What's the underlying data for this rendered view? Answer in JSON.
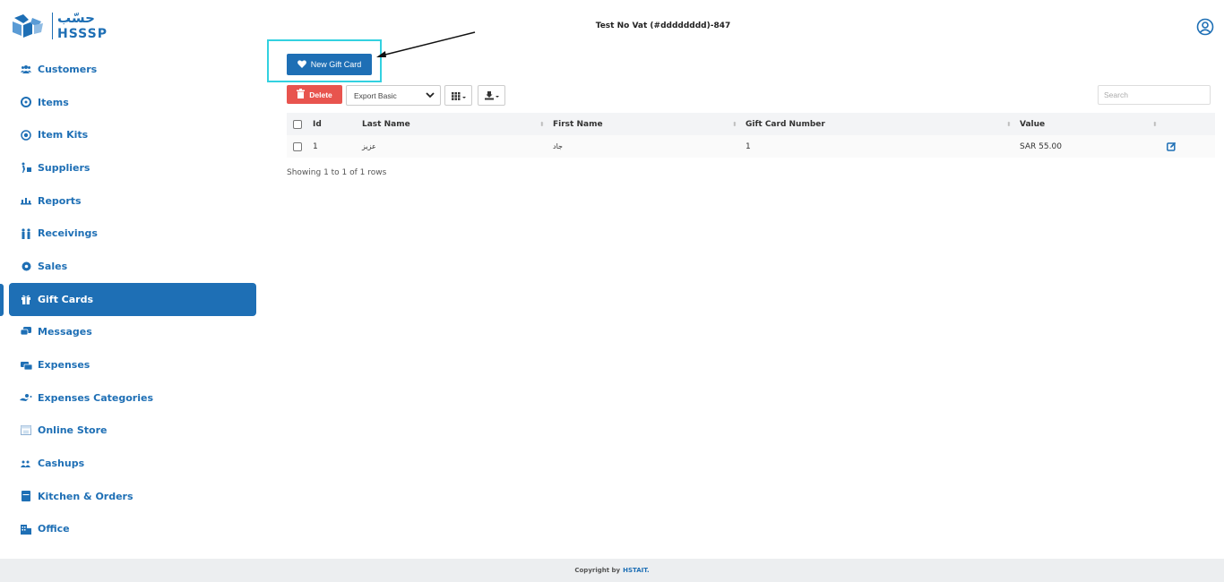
{
  "app": {
    "logo_ar": "حسّب",
    "logo_en": "HSSSP",
    "store_title": "Test No Vat (#dddddddd)-847"
  },
  "sidebar": {
    "items": [
      {
        "label": "Customers",
        "icon": "users-icon"
      },
      {
        "label": "Items",
        "icon": "items-icon"
      },
      {
        "label": "Item Kits",
        "icon": "item-kits-icon"
      },
      {
        "label": "Suppliers",
        "icon": "suppliers-icon"
      },
      {
        "label": "Reports",
        "icon": "reports-icon"
      },
      {
        "label": "Receivings",
        "icon": "receivings-icon"
      },
      {
        "label": "Sales",
        "icon": "sales-icon"
      },
      {
        "label": "Gift Cards",
        "icon": "gift-icon",
        "active": true
      },
      {
        "label": "Messages",
        "icon": "messages-icon"
      },
      {
        "label": "Expenses",
        "icon": "expenses-icon"
      },
      {
        "label": "Expenses Categories",
        "icon": "expenses-categories-icon"
      },
      {
        "label": "Online Store",
        "icon": "online-store-icon"
      },
      {
        "label": "Cashups",
        "icon": "cashups-icon"
      },
      {
        "label": "Kitchen & Orders",
        "icon": "kitchen-icon"
      },
      {
        "label": "Office",
        "icon": "office-icon"
      }
    ]
  },
  "toolbar": {
    "new_label": "New Gift Card",
    "delete_label": "Delete",
    "export_selected": "Export Basic",
    "search_placeholder": "Search"
  },
  "table": {
    "columns": [
      "Id",
      "Last Name",
      "First Name",
      "Gift Card Number",
      "Value"
    ],
    "rows": [
      {
        "id": "1",
        "last_name": "عزيز",
        "first_name": "جاد",
        "number": "1",
        "value": "SAR 55.00"
      }
    ],
    "summary": "Showing 1 to 1 of 1 rows"
  },
  "footer": {
    "copyright": "Copyright by",
    "brand": "HSTAIT."
  },
  "colors": {
    "primary": "#1e6fb5",
    "danger": "#e8544e",
    "highlight": "#33d1e0"
  }
}
